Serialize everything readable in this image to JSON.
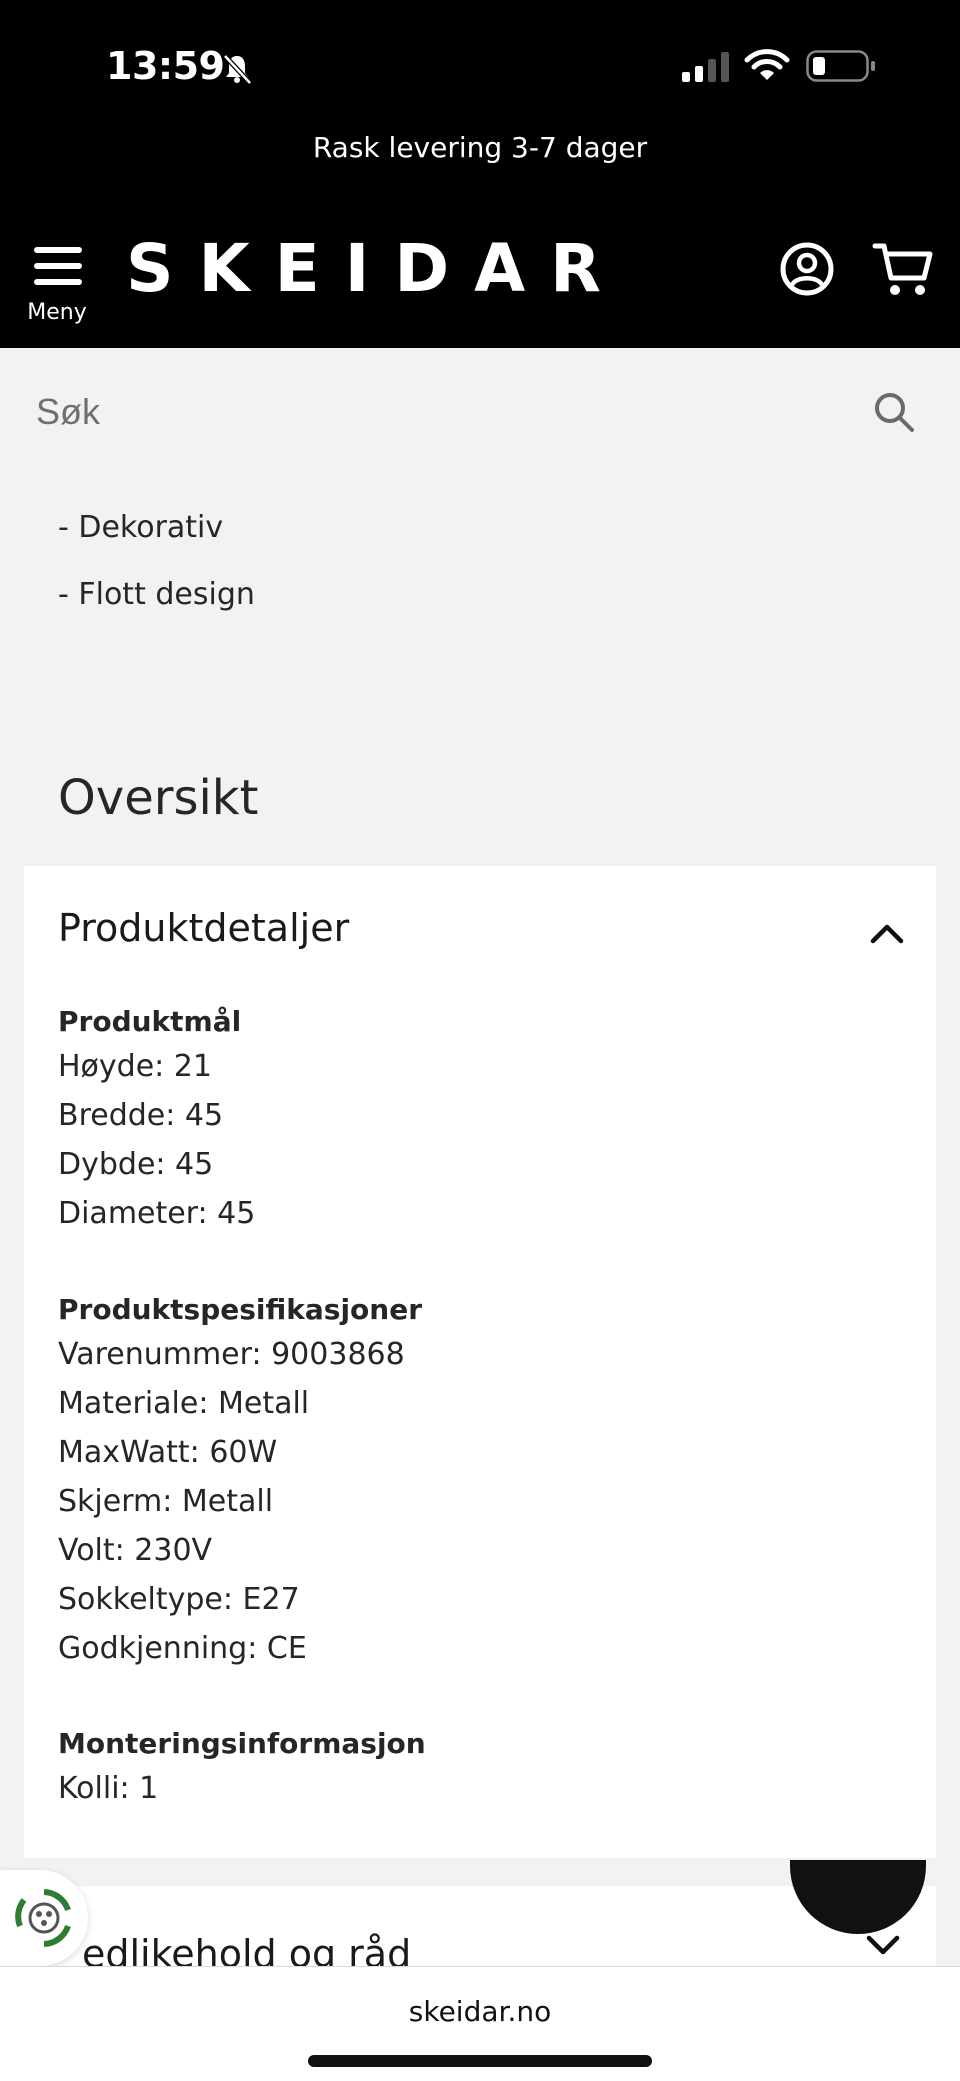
{
  "status_bar": {
    "time": "13:59"
  },
  "promo": {
    "text": "Rask levering 3-7 dager"
  },
  "header": {
    "menu_label": "Meny",
    "logo": "SKEIDAR"
  },
  "search": {
    "placeholder": "Søk"
  },
  "bullets": [
    "- Dekorativ",
    "- Flott design"
  ],
  "overview": {
    "title": "Oversikt"
  },
  "product_details": {
    "title": "Produktdetaljer",
    "groups": [
      {
        "heading": "Produktmål",
        "lines": [
          "Høyde: 21",
          "Bredde: 45",
          "Dybde: 45",
          "Diameter: 45"
        ]
      },
      {
        "heading": "Produktspesifikasjoner",
        "lines": [
          "Varenummer: 9003868",
          "Materiale: Metall",
          "MaxWatt: 60W",
          "Skjerm: Metall",
          "Volt: 230V",
          "Sokkeltype: E27",
          "Godkjenning: CE"
        ]
      },
      {
        "heading": "Monteringsinformasjon",
        "lines": [
          "Kolli: 1"
        ]
      }
    ]
  },
  "maintenance": {
    "title": "edlikehold og råd"
  },
  "browser": {
    "url": "skeidar.no"
  }
}
